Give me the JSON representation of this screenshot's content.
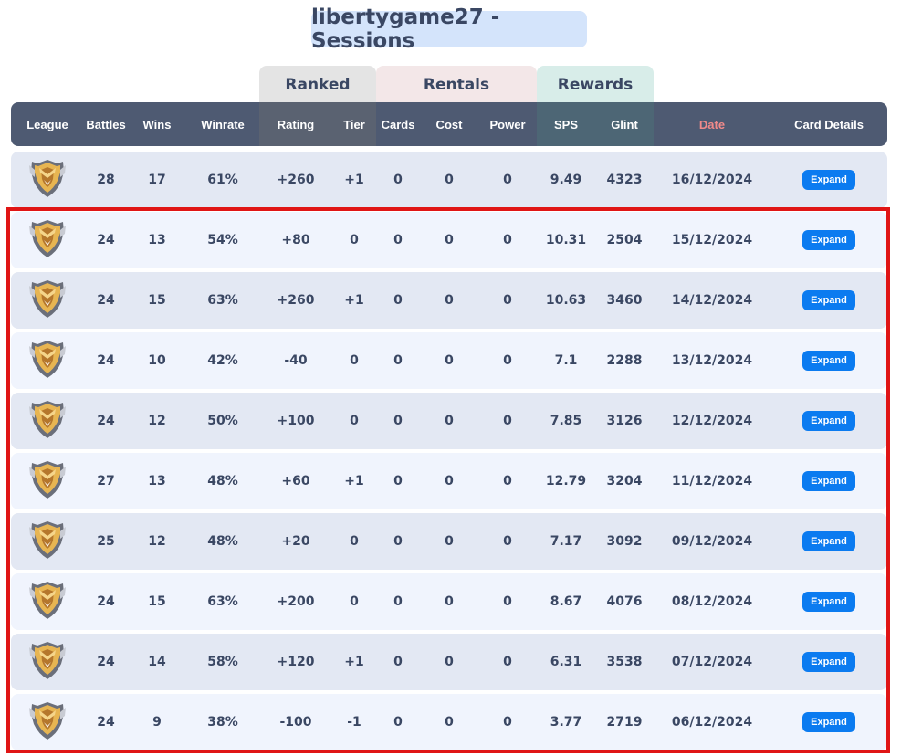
{
  "title": "libertygame27 - Sessions",
  "groups": {
    "ranked": "Ranked",
    "rentals": "Rentals",
    "rewards": "Rewards"
  },
  "columns": [
    {
      "key": "league",
      "label": "League"
    },
    {
      "key": "battles",
      "label": "Battles"
    },
    {
      "key": "wins",
      "label": "Wins"
    },
    {
      "key": "winrate",
      "label": "Winrate"
    },
    {
      "key": "rating",
      "label": "Rating"
    },
    {
      "key": "tier",
      "label": "Tier"
    },
    {
      "key": "cards",
      "label": "Cards"
    },
    {
      "key": "cost",
      "label": "Cost"
    },
    {
      "key": "power",
      "label": "Power"
    },
    {
      "key": "sps",
      "label": "SPS"
    },
    {
      "key": "glint",
      "label": "Glint"
    },
    {
      "key": "date",
      "label": "Date"
    },
    {
      "key": "details",
      "label": "Card Details"
    }
  ],
  "expand_label": "Expand",
  "league_icon": "gold-league-shield-icon",
  "colors": {
    "header_bg": "#4e5a72",
    "date_header": "#f08a8a",
    "expand_button": "#0b7bf0",
    "highlight_border": "#e01515"
  },
  "rows": [
    {
      "battles": "28",
      "wins": "17",
      "winrate": "61%",
      "rating": "+260",
      "tier": "+1",
      "cards": "0",
      "cost": "0",
      "power": "0",
      "sps": "9.49",
      "glint": "4323",
      "date": "16/12/2024"
    },
    {
      "battles": "24",
      "wins": "13",
      "winrate": "54%",
      "rating": "+80",
      "tier": "0",
      "cards": "0",
      "cost": "0",
      "power": "0",
      "sps": "10.31",
      "glint": "2504",
      "date": "15/12/2024"
    },
    {
      "battles": "24",
      "wins": "15",
      "winrate": "63%",
      "rating": "+260",
      "tier": "+1",
      "cards": "0",
      "cost": "0",
      "power": "0",
      "sps": "10.63",
      "glint": "3460",
      "date": "14/12/2024"
    },
    {
      "battles": "24",
      "wins": "10",
      "winrate": "42%",
      "rating": "-40",
      "tier": "0",
      "cards": "0",
      "cost": "0",
      "power": "0",
      "sps": "7.1",
      "glint": "2288",
      "date": "13/12/2024"
    },
    {
      "battles": "24",
      "wins": "12",
      "winrate": "50%",
      "rating": "+100",
      "tier": "0",
      "cards": "0",
      "cost": "0",
      "power": "0",
      "sps": "7.85",
      "glint": "3126",
      "date": "12/12/2024"
    },
    {
      "battles": "27",
      "wins": "13",
      "winrate": "48%",
      "rating": "+60",
      "tier": "+1",
      "cards": "0",
      "cost": "0",
      "power": "0",
      "sps": "12.79",
      "glint": "3204",
      "date": "11/12/2024"
    },
    {
      "battles": "25",
      "wins": "12",
      "winrate": "48%",
      "rating": "+20",
      "tier": "0",
      "cards": "0",
      "cost": "0",
      "power": "0",
      "sps": "7.17",
      "glint": "3092",
      "date": "09/12/2024"
    },
    {
      "battles": "24",
      "wins": "15",
      "winrate": "63%",
      "rating": "+200",
      "tier": "0",
      "cards": "0",
      "cost": "0",
      "power": "0",
      "sps": "8.67",
      "glint": "4076",
      "date": "08/12/2024"
    },
    {
      "battles": "24",
      "wins": "14",
      "winrate": "58%",
      "rating": "+120",
      "tier": "+1",
      "cards": "0",
      "cost": "0",
      "power": "0",
      "sps": "6.31",
      "glint": "3538",
      "date": "07/12/2024"
    },
    {
      "battles": "24",
      "wins": "9",
      "winrate": "38%",
      "rating": "-100",
      "tier": "-1",
      "cards": "0",
      "cost": "0",
      "power": "0",
      "sps": "3.77",
      "glint": "2719",
      "date": "06/12/2024"
    }
  ]
}
